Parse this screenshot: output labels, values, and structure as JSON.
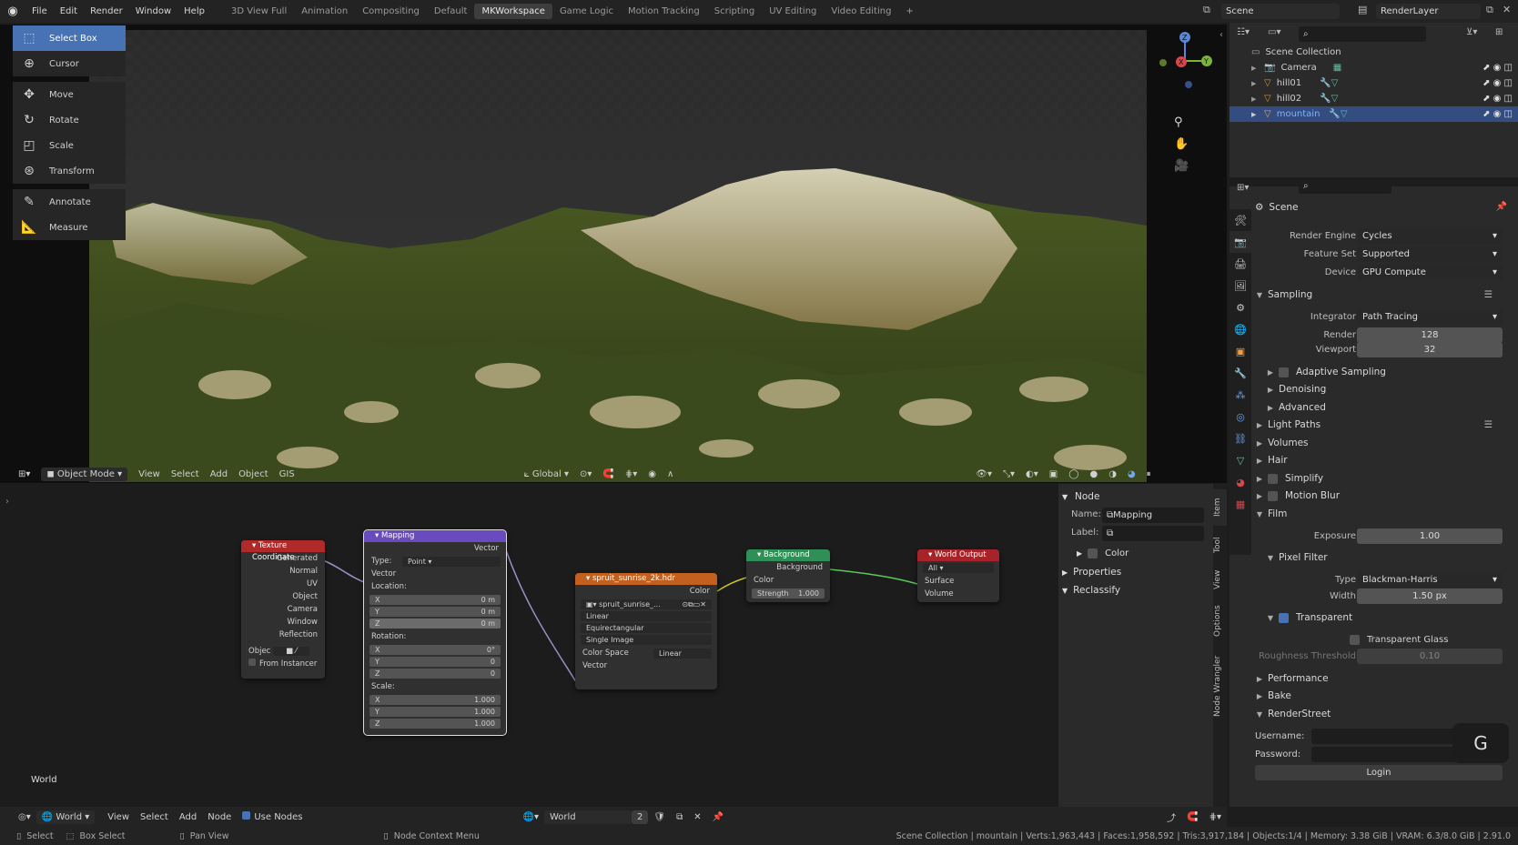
{
  "menu": [
    "File",
    "Edit",
    "Render",
    "Window",
    "Help"
  ],
  "workspaces": [
    "3D View Full",
    "Animation",
    "Compositing",
    "Default",
    "MKWorkspace",
    "Game Logic",
    "Motion Tracking",
    "Scripting",
    "UV Editing",
    "Video Editing"
  ],
  "active_workspace": "MKWorkspace",
  "scene_name": "Scene",
  "view_layer": "RenderLayer",
  "tools": [
    "Select Box",
    "Cursor",
    "Move",
    "Rotate",
    "Scale",
    "Transform",
    "Annotate",
    "Measure"
  ],
  "viewport_header": {
    "mode": "Object Mode",
    "menus": [
      "View",
      "Select",
      "Add",
      "Object",
      "GIS"
    ],
    "orientation": "Global"
  },
  "gizmo": {
    "z": "Z",
    "y": "Y",
    "x": "X"
  },
  "outliner": {
    "root": "Scene Collection",
    "items": [
      "Camera",
      "hill01",
      "hill02",
      "mountain"
    ],
    "selected": "mountain"
  },
  "nodes": {
    "texcoord": {
      "title": "Texture Coordinate",
      "outputs": [
        "Generated",
        "Normal",
        "UV",
        "Object",
        "Camera",
        "Window",
        "Reflection"
      ],
      "object_label": "Objec",
      "from_instancer": "From Instancer"
    },
    "mapping": {
      "title": "Mapping",
      "output": "Vector",
      "type_label": "Type:",
      "type_value": "Point",
      "vector_label": "Vector",
      "location_label": "Location:",
      "loc": [
        [
          "X",
          "0 m"
        ],
        [
          "Y",
          "0 m"
        ],
        [
          "Z",
          "0 m"
        ]
      ],
      "rotation_label": "Rotation:",
      "rot": [
        [
          "X",
          "0°"
        ],
        [
          "Y",
          "0"
        ],
        [
          "Z",
          "0"
        ]
      ],
      "scale_label": "Scale:",
      "scale": [
        [
          "X",
          "1.000"
        ],
        [
          "Y",
          "1.000"
        ],
        [
          "Z",
          "1.000"
        ]
      ]
    },
    "envtex": {
      "title": "spruit_sunrise_2k.hdr",
      "output": "Color",
      "image": "spruit_sunrise_...",
      "interp": "Linear",
      "proj": "Equirectangular",
      "source": "Single Image",
      "cs_label": "Color Space",
      "cs_value": "Linear",
      "input": "Vector"
    },
    "background": {
      "title": "Background",
      "output": "Background",
      "color": "Color",
      "strength_label": "Strength",
      "strength": "1.000"
    },
    "worldout": {
      "title": "World Output",
      "target": "All",
      "surface": "Surface",
      "volume": "Volume"
    }
  },
  "node_world_label": "World",
  "npanel": {
    "section": "Node",
    "name_label": "Name:",
    "name_value": "Mapping",
    "label_label": "Label:",
    "color": "Color",
    "properties": "Properties",
    "reclassify": "Reclassify",
    "tabs": [
      "Item",
      "Tool",
      "View",
      "Options",
      "Node Wrangler"
    ]
  },
  "node_header": {
    "world": "World",
    "menus": [
      "View",
      "Select",
      "Add",
      "Node"
    ],
    "use_nodes": "Use Nodes",
    "datablock": "World",
    "users": "2"
  },
  "properties": {
    "title": "Scene",
    "render_engine_label": "Render Engine",
    "render_engine": "Cycles",
    "feature_set_label": "Feature Set",
    "feature_set": "Supported",
    "device_label": "Device",
    "device": "GPU Compute",
    "sampling": "Sampling",
    "integrator_label": "Integrator",
    "integrator": "Path Tracing",
    "render_label": "Render",
    "render": "128",
    "viewport_label": "Viewport",
    "viewport": "32",
    "adaptive": "Adaptive Sampling",
    "denoising": "Denoising",
    "advanced": "Advanced",
    "light_paths": "Light Paths",
    "volumes": "Volumes",
    "hair": "Hair",
    "simplify": "Simplify",
    "motion_blur": "Motion Blur",
    "film": "Film",
    "exposure_label": "Exposure",
    "exposure": "1.00",
    "pixel_filter": "Pixel Filter",
    "type_label": "Type",
    "type": "Blackman-Harris",
    "width_label": "Width",
    "width": "1.50 px",
    "transparent": "Transparent",
    "transparent_glass": "Transparent Glass",
    "roughness_label": "Roughness Threshold",
    "roughness": "0.10",
    "performance": "Performance",
    "bake": "Bake",
    "renderstreet": "RenderStreet",
    "username_label": "Username:",
    "password_label": "Password:",
    "login": "Login"
  },
  "status": {
    "select": "Select",
    "box_select": "Box Select",
    "pan_view": "Pan View",
    "context": "Node Context Menu",
    "info": "Scene Collection | mountain | Verts:1,963,443 | Faces:1,958,592 | Tris:3,917,184 | Objects:1/4 | Memory: 3.38 GiB | VRAM: 6.3/8.0 GiB | 2.91.0"
  },
  "colors": {
    "accent": "#4772b3",
    "texcoord": "#b02a2a",
    "mapping": "#6a4bbf",
    "envtex": "#c2611f",
    "background": "#2f8f57",
    "worldout": "#a62329"
  }
}
